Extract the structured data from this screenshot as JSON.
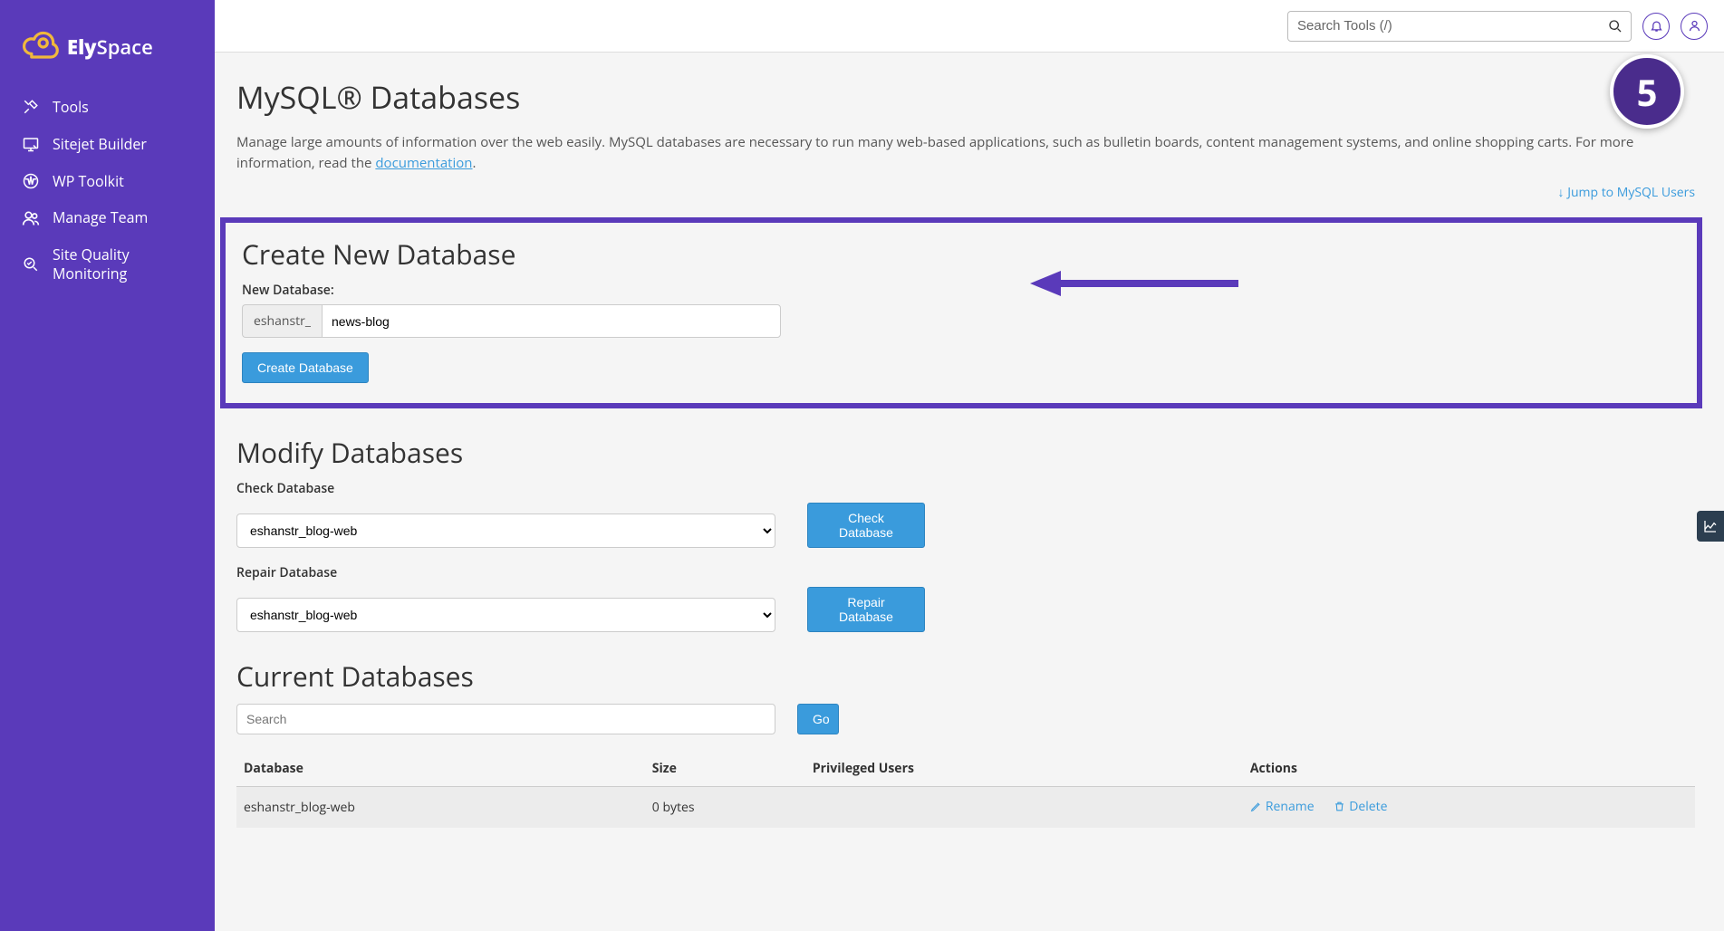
{
  "brand": {
    "name_a": "Ely",
    "name_b": "Space"
  },
  "sidebar": {
    "items": [
      {
        "label": "Tools"
      },
      {
        "label": "Sitejet Builder"
      },
      {
        "label": "WP Toolkit"
      },
      {
        "label": "Manage Team"
      },
      {
        "label": "Site Quality Monitoring"
      }
    ]
  },
  "topbar": {
    "search_placeholder": "Search Tools (/)"
  },
  "page": {
    "title": "MySQL® Databases",
    "desc_a": "Manage large amounts of information over the web easily. MySQL databases are necessary to run many web-based applications, such as bulletin boards, content management systems, and online shopping carts. For more information, read the ",
    "desc_link": "documentation",
    "desc_b": ".",
    "jump_link": "Jump to MySQL Users"
  },
  "create": {
    "heading": "Create New Database",
    "label": "New Database:",
    "prefix": "eshanstr_",
    "value": "news-blog",
    "button": "Create Database"
  },
  "modify": {
    "heading": "Modify Databases",
    "check_label": "Check Database",
    "check_value": "eshanstr_blog-web",
    "check_btn": "Check Database",
    "repair_label": "Repair Database",
    "repair_value": "eshanstr_blog-web",
    "repair_btn": "Repair Database"
  },
  "current": {
    "heading": "Current Databases",
    "search_placeholder": "Search",
    "go_btn": "Go",
    "cols": {
      "db": "Database",
      "size": "Size",
      "users": "Privileged Users",
      "actions": "Actions"
    },
    "rows": [
      {
        "db": "eshanstr_blog-web",
        "size": "0 bytes",
        "users": "",
        "rename": "Rename",
        "delete": "Delete"
      }
    ]
  },
  "annotation": {
    "step": "5"
  }
}
